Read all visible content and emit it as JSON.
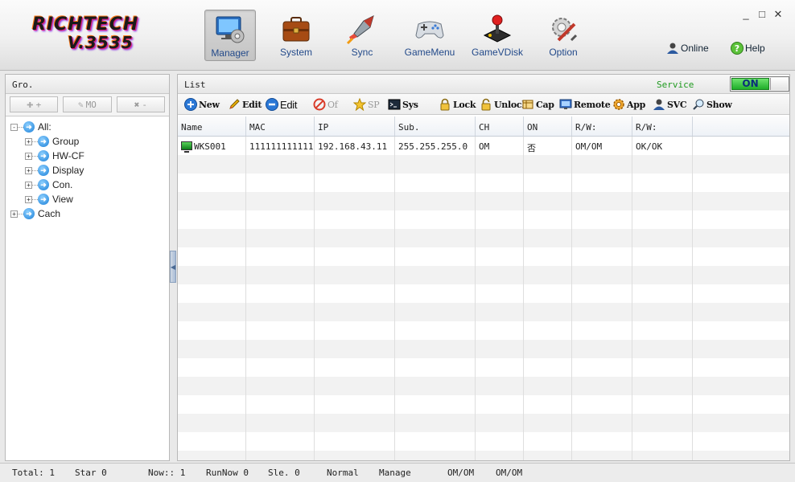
{
  "app": {
    "logo_line1": "RICHTECH",
    "logo_line2": "V.3535",
    "accent_color": "#1a7fd8",
    "logo_colors": [
      "#e0217a",
      "#ff7a1a",
      "#8a2be2"
    ]
  },
  "nav": [
    {
      "label": "Manager",
      "icon": "manager-icon",
      "active": true
    },
    {
      "label": "System",
      "icon": "briefcase-icon",
      "active": false
    },
    {
      "label": "Sync",
      "icon": "rocket-icon",
      "active": false
    },
    {
      "label": "GameMenu",
      "icon": "gamepad-icon",
      "active": false
    },
    {
      "label": "GameVDisk",
      "icon": "joystick-icon",
      "active": false
    },
    {
      "label": "Option",
      "icon": "gear-tools-icon",
      "active": false
    }
  ],
  "window_controls": {
    "minimize": "_",
    "maximize": "□",
    "close": "✕"
  },
  "top_links": {
    "online": "Online",
    "help": "Help"
  },
  "left_panel": {
    "title": "Gro.",
    "tools": [
      {
        "label": "+",
        "icon": "add-group-icon"
      },
      {
        "label": "MO",
        "icon": "pencil-icon"
      },
      {
        "label": "-",
        "icon": "remove-group-icon"
      }
    ],
    "tree": {
      "root": {
        "label": "All:",
        "expander": "-"
      },
      "children": [
        {
          "label": "Group",
          "expander": "+"
        },
        {
          "label": "HW-CF",
          "expander": "+"
        },
        {
          "label": "Display",
          "expander": "+"
        },
        {
          "label": "Con.",
          "expander": "+"
        },
        {
          "label": "View",
          "expander": "+"
        }
      ],
      "cache": {
        "label": "Cach",
        "expander": "+"
      }
    }
  },
  "right_panel": {
    "title": "List",
    "service_label": "Service",
    "service_toggle": "ON",
    "service_color": "#1f9a1f",
    "actions": [
      {
        "label": "New",
        "icon": "new-icon"
      },
      {
        "label": "Edit",
        "icon": "pencil-edit-icon"
      },
      {
        "label": "Edit",
        "icon": "minus-circle-icon"
      },
      {
        "label": "Of",
        "icon": "forbidden-icon"
      },
      {
        "label": "SP",
        "icon": "star-icon"
      },
      {
        "label": "Sys",
        "icon": "terminal-icon"
      },
      {
        "label": "Lock",
        "icon": "lock-icon"
      },
      {
        "label": "Unlock",
        "icon": "unlock-icon"
      },
      {
        "label": "Cap",
        "icon": "capture-icon"
      },
      {
        "label": "Remote",
        "icon": "monitor-icon"
      },
      {
        "label": "App",
        "icon": "app-gear-icon"
      },
      {
        "label": "SVC",
        "icon": "svc-user-icon"
      },
      {
        "label": "Show",
        "icon": "magnifier-icon"
      }
    ],
    "columns": [
      "Name",
      "MAC",
      "IP",
      "Sub.",
      "CH",
      "ON",
      "R/W:",
      "R/W:",
      ""
    ],
    "rows": [
      [
        "WKS001",
        "111111111111",
        "192.168.43.11",
        "255.255.255.0",
        "OM",
        "否",
        "OM/OM",
        "OK/OK",
        ""
      ]
    ]
  },
  "status": {
    "total": "Total: 1",
    "star": "Star 0",
    "now": "Now:: 1",
    "runnow": "RunNow 0",
    "sle": "Sle. 0",
    "mode": "Normal",
    "manage": "Manage",
    "om1": "OM/OM",
    "om2": "OM/OM"
  }
}
